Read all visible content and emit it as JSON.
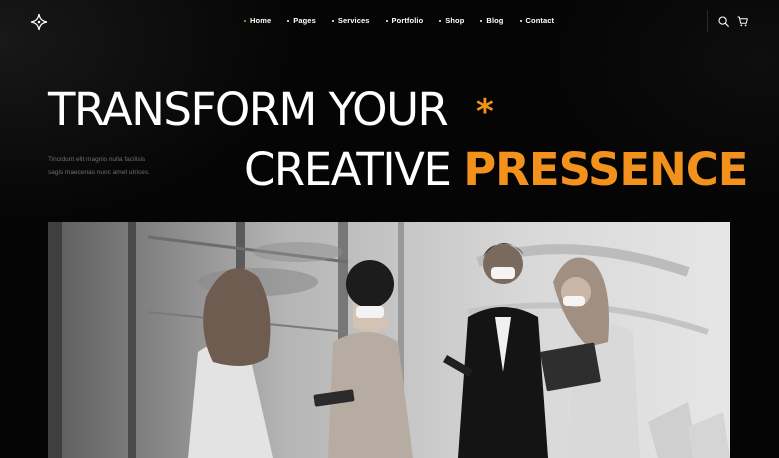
{
  "nav": {
    "items": [
      {
        "label": "Home",
        "active": true
      },
      {
        "label": "Pages",
        "active": false
      },
      {
        "label": "Services",
        "active": false
      },
      {
        "label": "Portfolio",
        "active": false
      },
      {
        "label": "Shop",
        "active": false
      },
      {
        "label": "Blog",
        "active": false
      },
      {
        "label": "Contact",
        "active": false
      }
    ]
  },
  "tools": {
    "search_icon": "search-icon",
    "cart_icon": "cart-icon"
  },
  "hero": {
    "line1": "TRANSFORM YOUR",
    "star": "*",
    "line2_plain": "CREATIVE ",
    "line2_accent": "PRESSENCE",
    "blurb": "Tincidunt elit magnis nulla facilisis sagis maecenas nunc amet utrices."
  },
  "colors": {
    "accent": "#f2911b",
    "background": "#050505",
    "text": "#ffffff",
    "muted": "#6f6f6f"
  },
  "image": {
    "icon": "team-meeting-photo"
  }
}
